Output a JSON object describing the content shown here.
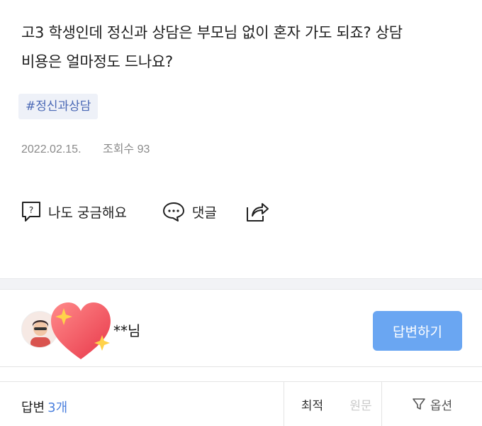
{
  "question": {
    "line1": "고3 학생인데 정신과 상담은 부모님 없이 혼자 가도 되죠? 상담",
    "line2": "비용은 얼마정도 드나요?"
  },
  "tag": "#정신과상담",
  "meta": {
    "date": "2022.02.15.",
    "views": "조회수 93"
  },
  "actions": {
    "curious": "나도 궁금해요",
    "comment": "댓글"
  },
  "answerer": {
    "nickname": "**님"
  },
  "answer_button": "답변하기",
  "answers": {
    "title": "답변",
    "count": "3개",
    "sort": {
      "best": "최적",
      "original": "원문",
      "options": "옵션"
    }
  },
  "colors": {
    "accent": "#6aa6f2",
    "tag_text": "#4a68b5",
    "tag_bg": "#eef1f8",
    "count": "#4a7fdd"
  }
}
